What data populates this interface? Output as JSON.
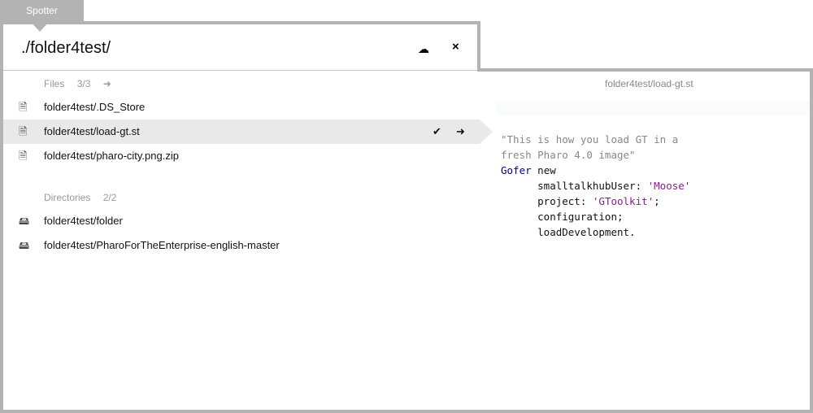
{
  "tab": {
    "label": "Spotter"
  },
  "header": {
    "query": "./folder4test/",
    "cloud_icon": "cloud-icon",
    "close_icon": "close-icon"
  },
  "files": {
    "label": "Files",
    "count": "3/3",
    "items": [
      "folder4test/.DS_Store",
      "folder4test/load-gt.st",
      "folder4test/pharo-city.png.zip"
    ],
    "selected": 1
  },
  "directories": {
    "label": "Directories",
    "count": "2/2",
    "items": [
      "folder4test/folder",
      "folder4test/PharoForTheEnterprise-english-master"
    ]
  },
  "preview": {
    "title": "folder4test/load-gt.st",
    "code": {
      "comment1": "\"This is how you load GT in a",
      "comment2": "fresh Pharo 4.0 image\"",
      "cls": "Gofer",
      "l3rest": " new",
      "l4a": "      smalltalkhubUser: ",
      "l4s": "'Moose'",
      "l5a": "      project: ",
      "l5s": "'GToolkit'",
      "l5b": ";",
      "l6": "      configuration;",
      "l7": "      loadDevelopment."
    }
  },
  "colors": {
    "border": "#b3b3b3",
    "selection": "#e9e9e9",
    "string": "#8b1c8b",
    "class": "#000080",
    "comment": "#888888"
  }
}
